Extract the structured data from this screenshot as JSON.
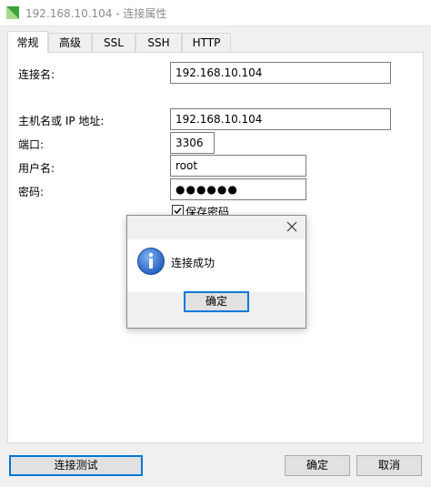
{
  "window": {
    "title": "192.168.10.104 - 连接属性",
    "icon": "navicat-logo-icon"
  },
  "tabs": [
    {
      "label": "常规",
      "active": true
    },
    {
      "label": "高级",
      "active": false
    },
    {
      "label": "SSL",
      "active": false
    },
    {
      "label": "SSH",
      "active": false
    },
    {
      "label": "HTTP",
      "active": false
    }
  ],
  "form": {
    "connection_name_label": "连接名:",
    "connection_name_value": "192.168.10.104",
    "host_label": "主机名或 IP 地址:",
    "host_value": "192.168.10.104",
    "port_label": "端口:",
    "port_value": "3306",
    "user_label": "用户名:",
    "user_value": "root",
    "password_label": "密码:",
    "password_value": "●●●●●●",
    "save_password_label": "保存密码",
    "save_password_checked": true
  },
  "dialog": {
    "message": "连接成功",
    "ok_label": "确定",
    "icon": "info-icon",
    "close_icon": "close-icon"
  },
  "footer": {
    "test_label": "连接测试",
    "ok_label": "确定",
    "cancel_label": "取消"
  },
  "colors": {
    "accent": "#0078d7",
    "info_blue": "#2f6fd0",
    "logo_green": "#3aa33a"
  }
}
